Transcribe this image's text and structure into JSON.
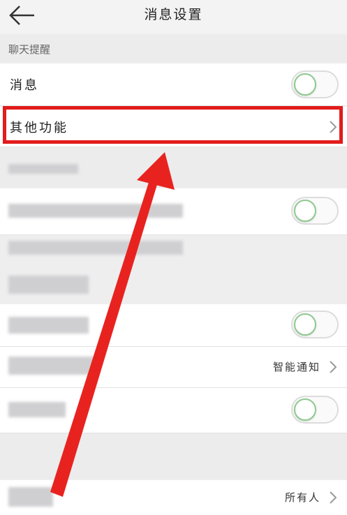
{
  "header": {
    "title": "消息设置",
    "back_icon": "arrow-left-icon"
  },
  "section_chat": {
    "label": "聊天提醒"
  },
  "rows": {
    "message": {
      "label": "消息"
    },
    "other": {
      "label": "其他功能"
    },
    "smart": {
      "value": "智能通知"
    },
    "everyone": {
      "value": "所有人"
    }
  },
  "colors": {
    "highlight": "#e21b1b",
    "arrow": "#e8231f",
    "toggle_knob_border": "#8fc98f"
  }
}
